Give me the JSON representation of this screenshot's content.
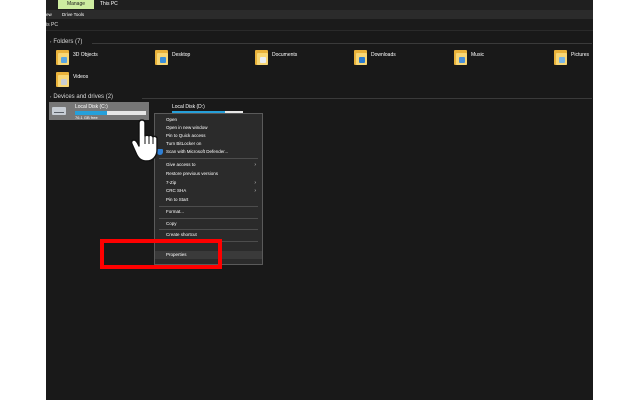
{
  "ribbon": {
    "tab_manage": "Manage",
    "tab_this_pc": "This PC",
    "sub_left": "ew",
    "sub_drive_tools": "Drive Tools"
  },
  "address": {
    "path": "is PC"
  },
  "folders_group": {
    "title": "Folders (7)",
    "items": [
      {
        "label": "3D Objects",
        "icon": "3d-objects-folder-icon"
      },
      {
        "label": "Desktop",
        "icon": "desktop-folder-icon"
      },
      {
        "label": "Documents",
        "icon": "documents-folder-icon"
      },
      {
        "label": "Downloads",
        "icon": "downloads-folder-icon"
      },
      {
        "label": "Music",
        "icon": "music-folder-icon"
      },
      {
        "label": "Pictures",
        "icon": "pictures-folder-icon"
      },
      {
        "label": "Videos",
        "icon": "videos-folder-icon"
      }
    ]
  },
  "drives_group": {
    "title": "Devices and drives (2)",
    "drives": [
      {
        "label": "Local Disk (C:)",
        "sub": "76.1 GB free",
        "used_fraction": 0.45,
        "selected": true
      },
      {
        "label": "Local Disk (D:)",
        "sub": "",
        "used_fraction": 0.75,
        "selected": false
      }
    ]
  },
  "context_menu": {
    "items": [
      "Open",
      "Open in new window",
      "Pin to Quick access",
      "Turn BitLocker on",
      "Scan with Microsoft Defender...",
      "Give access to",
      "Restore previous versions",
      "7-Zip",
      "CRC SHA",
      "Pin to Start",
      "Format...",
      "Copy",
      "Create shortcut",
      "Properties"
    ]
  },
  "colors": {
    "folder_back": "#e9b23b",
    "folder_front": "#f8d775",
    "accent_bar": "#26a0da",
    "highlight": "#ff0000",
    "manage_tab": "#cdeca0"
  }
}
